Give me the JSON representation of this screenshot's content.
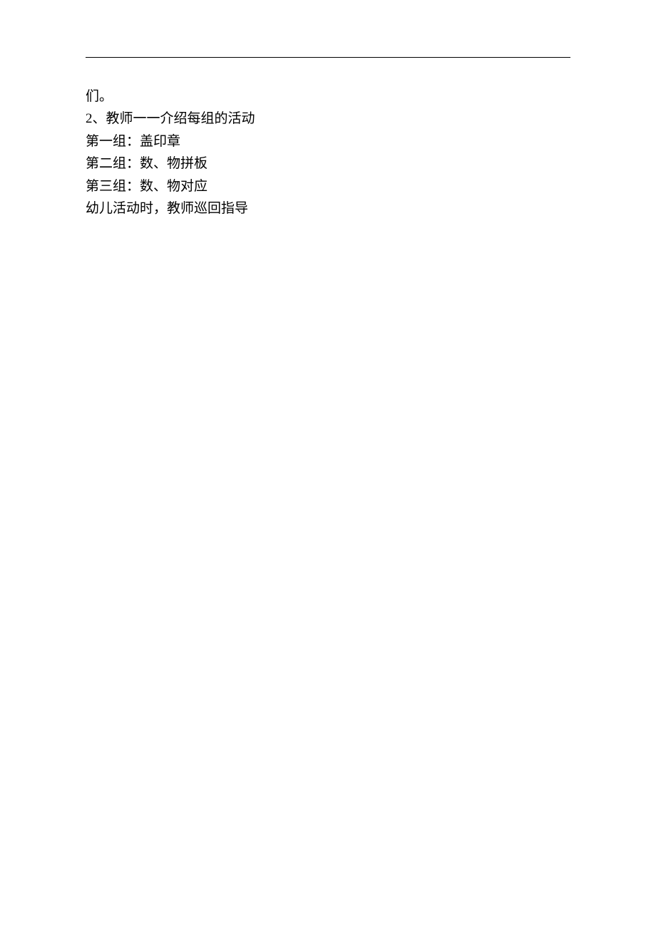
{
  "document": {
    "lines": [
      "们。",
      "2、教师一一介绍每组的活动",
      "第一组：盖印章",
      "第二组：数、物拼板",
      "第三组：数、物对应",
      "幼儿活动时，教师巡回指导"
    ]
  }
}
